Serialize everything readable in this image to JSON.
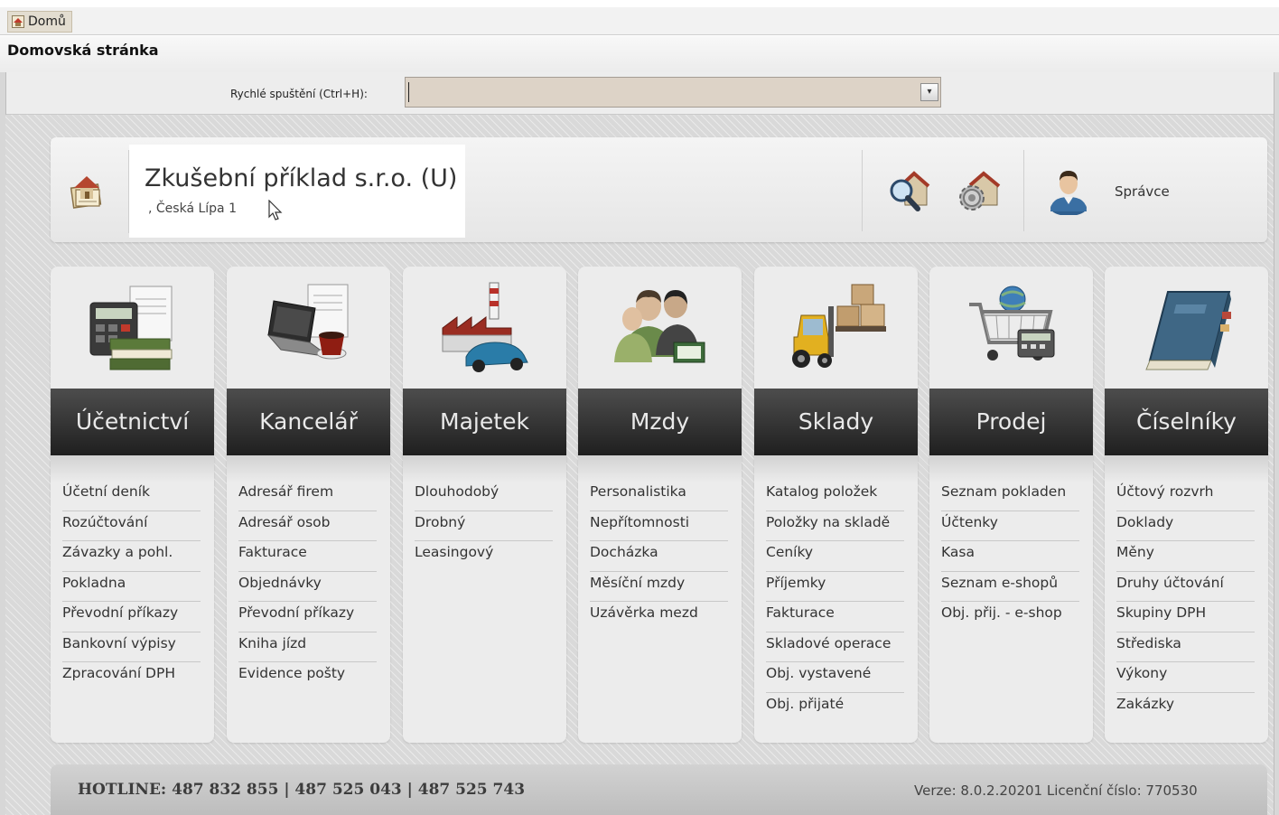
{
  "tabbar": {
    "home_tab_label": "Domů"
  },
  "page_title": "Domovská stránka",
  "quick_start": {
    "label": "Rychlé spuštění (Ctrl+H):",
    "value": ""
  },
  "header": {
    "company_name": "Zkušební příklad s.r.o. (U)",
    "company_address": ", Česká Lípa 1",
    "user_name": "Správce"
  },
  "modules": [
    {
      "title": "Účetnictví",
      "icon": "accounting-icon",
      "items": [
        "Účetní deník",
        "Rozúčtování",
        "Závazky a pohl.",
        "Pokladna",
        "Převodní příkazy",
        "Bankovní výpisy",
        "Zpracování DPH"
      ]
    },
    {
      "title": "Kancelář",
      "icon": "office-laptop-icon",
      "items": [
        "Adresář firem",
        "Adresář osob",
        "Fakturace",
        "Objednávky",
        "Převodní příkazy",
        "Kniha jízd",
        "Evidence pošty"
      ]
    },
    {
      "title": "Majetek",
      "icon": "factory-car-icon",
      "items": [
        "Dlouhodobý",
        "Drobný",
        "Leasingový"
      ]
    },
    {
      "title": "Mzdy",
      "icon": "people-money-icon",
      "items": [
        "Personalistika",
        "Nepřítomnosti",
        "Docházka",
        "Měsíční mzdy",
        "Uzávěrka mezd"
      ]
    },
    {
      "title": "Sklady",
      "icon": "forklift-icon",
      "items": [
        "Katalog položek",
        "Položky na skladě",
        "Ceníky",
        "Příjemky",
        "Fakturace",
        "Skladové operace",
        "Obj. vystavené",
        "Obj. přijaté"
      ]
    },
    {
      "title": "Prodej",
      "icon": "shopping-cart-icon",
      "items": [
        "Seznam pokladen",
        "Účtenky",
        "Kasa",
        "Seznam e-shopů",
        "Obj. přij. - e-shop"
      ]
    },
    {
      "title": "Číselníky",
      "icon": "book-icon",
      "items": [
        "Účtový rozvrh",
        "Doklady",
        "Měny",
        "Druhy účtování",
        "Skupiny DPH",
        "Střediska",
        "Výkony",
        "Zakázky"
      ]
    }
  ],
  "footer": {
    "hotline": "HOTLINE:  487 832 855  |  487 525 043  |  487 525 743",
    "version": "Verze: 8.0.2.20201  Licenční číslo: 770530"
  }
}
